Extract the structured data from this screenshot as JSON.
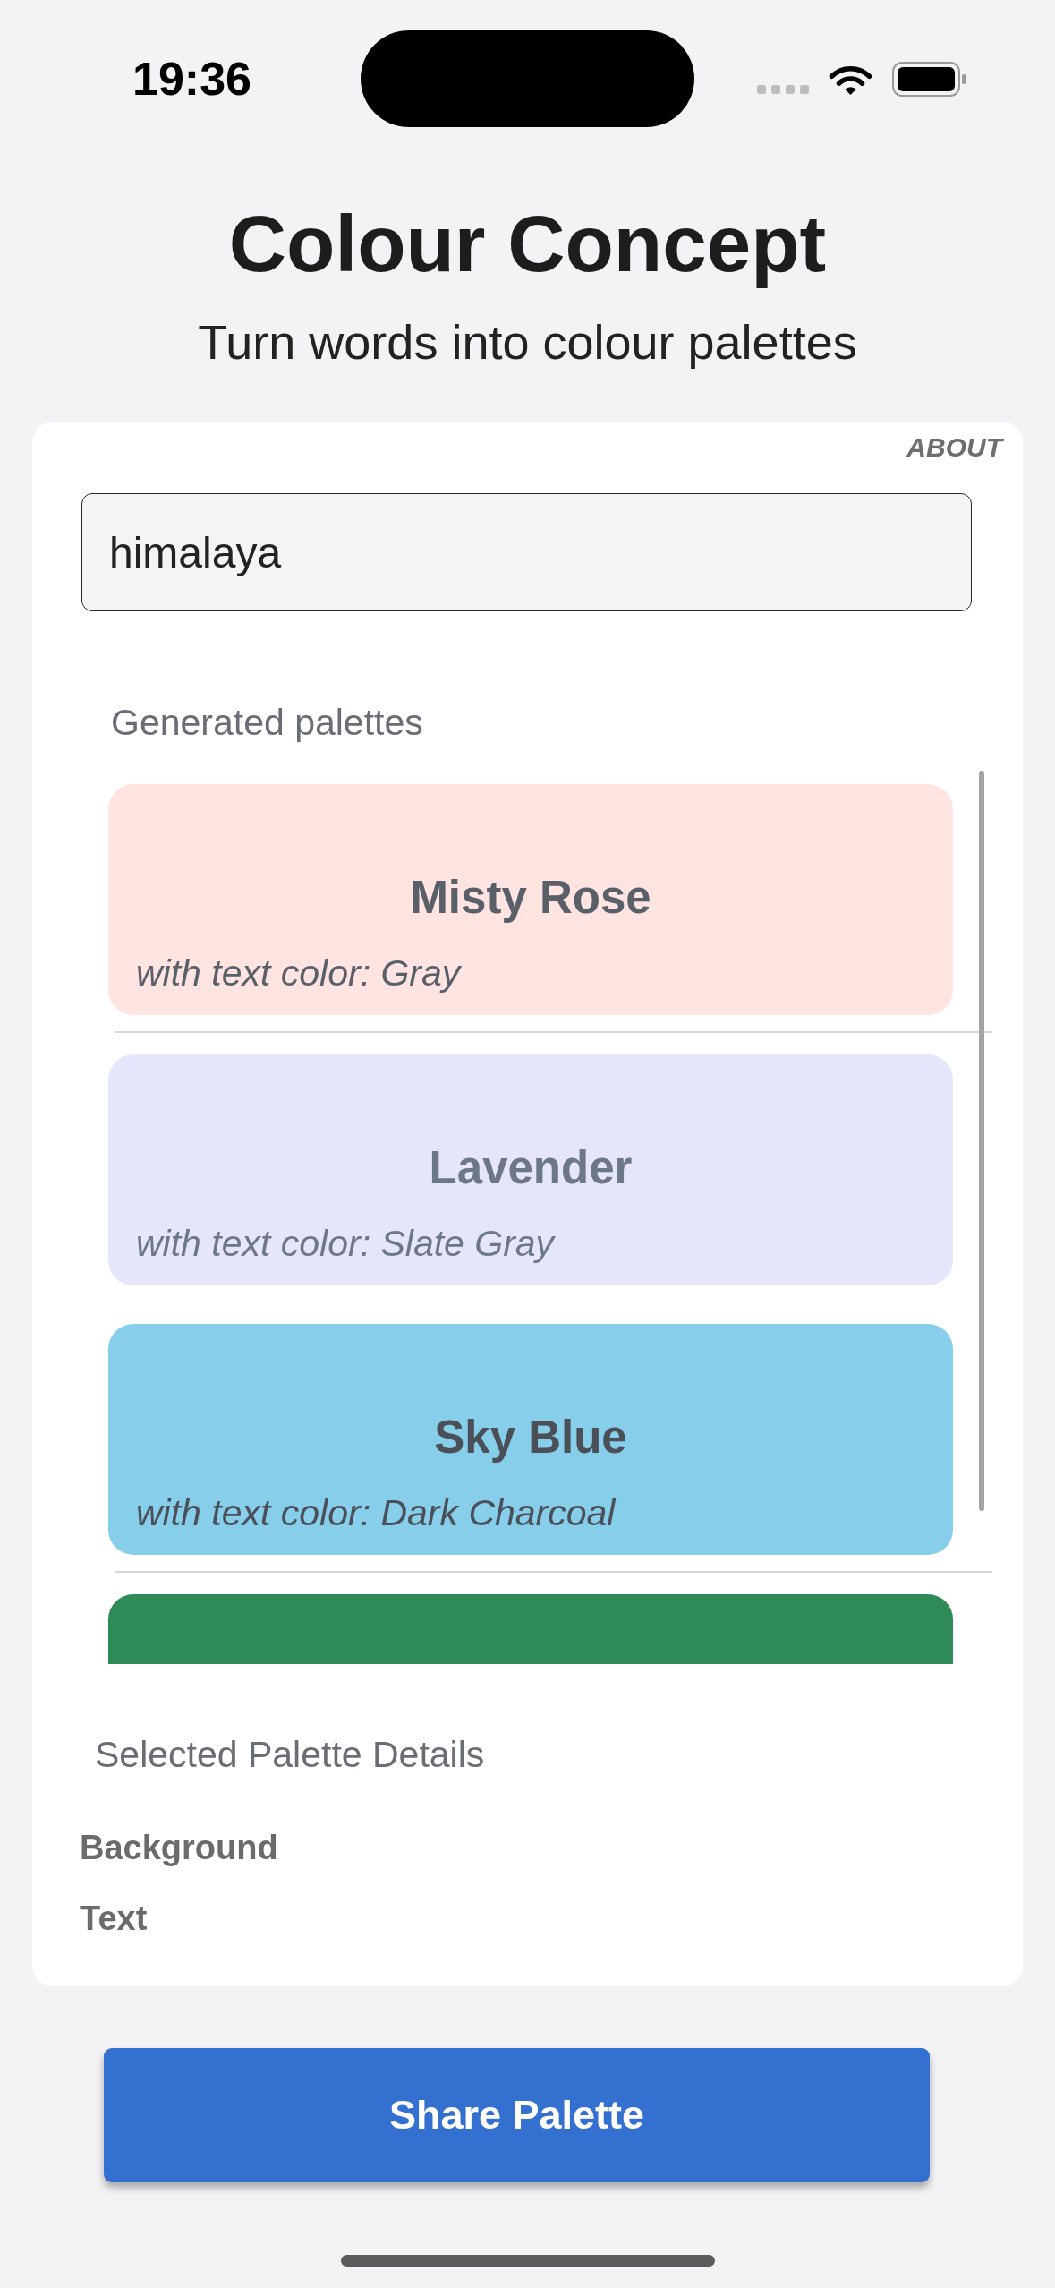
{
  "status_bar": {
    "time": "19:36"
  },
  "header": {
    "title": "Colour Concept",
    "subtitle": "Turn words into colour palettes"
  },
  "panel": {
    "about_link": "ABOUT",
    "search": {
      "value": "himalaya"
    },
    "palettes": {
      "heading": "Generated palettes",
      "items": [
        {
          "name": "Misty Rose",
          "caption": "with text color: Gray",
          "color": "#ffe4e1",
          "text": {
            "color": "#59606a"
          }
        },
        {
          "name": "Lavender",
          "caption": "with text color: Slate Gray",
          "color": "#e6e6fa",
          "text": {
            "color": "#6c7888"
          }
        },
        {
          "name": "Sky Blue",
          "caption": "with text color: Dark Charcoal",
          "color": "#87ceeb",
          "text": {
            "color": "#4b4f58"
          }
        },
        {
          "color": "#2e8b57"
        }
      ]
    },
    "details": {
      "heading": "Selected Palette Details",
      "rows": [
        "Background",
        "Text"
      ]
    }
  },
  "share_button": {
    "label": "Share Palette"
  }
}
